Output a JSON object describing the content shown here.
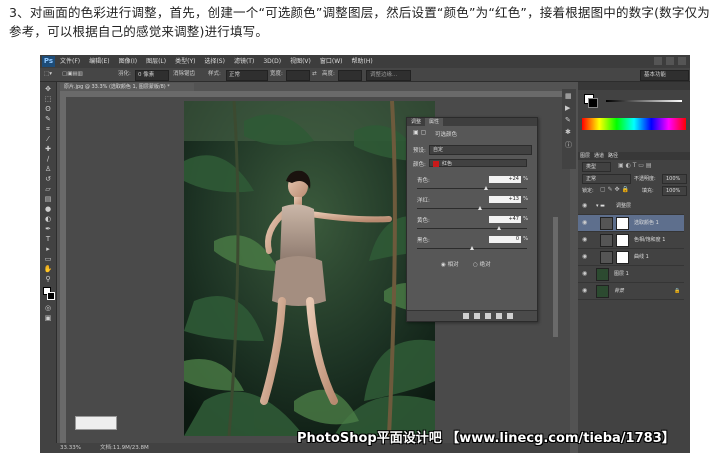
{
  "instruction": {
    "text": "3、对画面的色彩进行调整，首先，创建一个“可选颜色”调整图层，然后设置“颜色”为“红色”，接着根据图中的数字(数字仅为参考，可以根据自己的感觉来调整)进行填写。"
  },
  "app": {
    "logo": "Ps",
    "menu": [
      "文件(F)",
      "编辑(E)",
      "图像(I)",
      "图层(L)",
      "类型(Y)",
      "选择(S)",
      "滤镜(T)",
      "3D(D)",
      "视图(V)",
      "窗口(W)",
      "帮助(H)"
    ],
    "workspace": "基本功能"
  },
  "options_bar": {
    "feather_label": "羽化:",
    "feather_value": "0 像素",
    "antialias": "消除锯齿",
    "style_label": "样式:",
    "style_value": "正常",
    "width_label": "宽度:",
    "height_label": "高度:",
    "refine_edge": "调整边缘..."
  },
  "document": {
    "tab_title": "原片.jpg @ 33.3% (选取颜色 1, 图层蒙版/8) *",
    "zoom": "33.33%",
    "doc_size": "文档:11.9M/23.8M"
  },
  "adjustments_panel": {
    "tab_adjust": "调整",
    "tab_properties": "属性",
    "title": "可选颜色",
    "preset_label": "预设:",
    "preset_value": "自定",
    "color_label": "颜色:",
    "color_value": "红色",
    "color_swatch": "#c8191a",
    "rows": [
      {
        "label": "青色:",
        "value": "+24"
      },
      {
        "label": "洋红:",
        "value": "+13"
      },
      {
        "label": "黄色:",
        "value": "+47"
      },
      {
        "label": "黑色:",
        "value": "0"
      }
    ],
    "percent": "%",
    "method_relative": "相对",
    "method_absolute": "绝对"
  },
  "layers_panel": {
    "tab_layers": "图层",
    "tab_channels": "通道",
    "tab_paths": "路径",
    "kind_label": "类型",
    "blend_mode": "正常",
    "opacity_label": "不透明度:",
    "opacity_value": "100%",
    "lock_label": "锁定:",
    "fill_label": "填充:",
    "fill_value": "100%",
    "layers": [
      {
        "name": "调整层",
        "type": "group"
      },
      {
        "name": "选取颜色 1",
        "type": "adjustment",
        "selected": true
      },
      {
        "name": "色相/饱和度 1",
        "type": "adjustment"
      },
      {
        "name": "曲线 1",
        "type": "adjustment"
      },
      {
        "name": "图层 1",
        "type": "pixel"
      },
      {
        "name": "背景",
        "type": "background"
      }
    ]
  },
  "watermark": {
    "text": "PhotoShop平面设计吧 【www.linecg.com/tieba/1783】"
  }
}
